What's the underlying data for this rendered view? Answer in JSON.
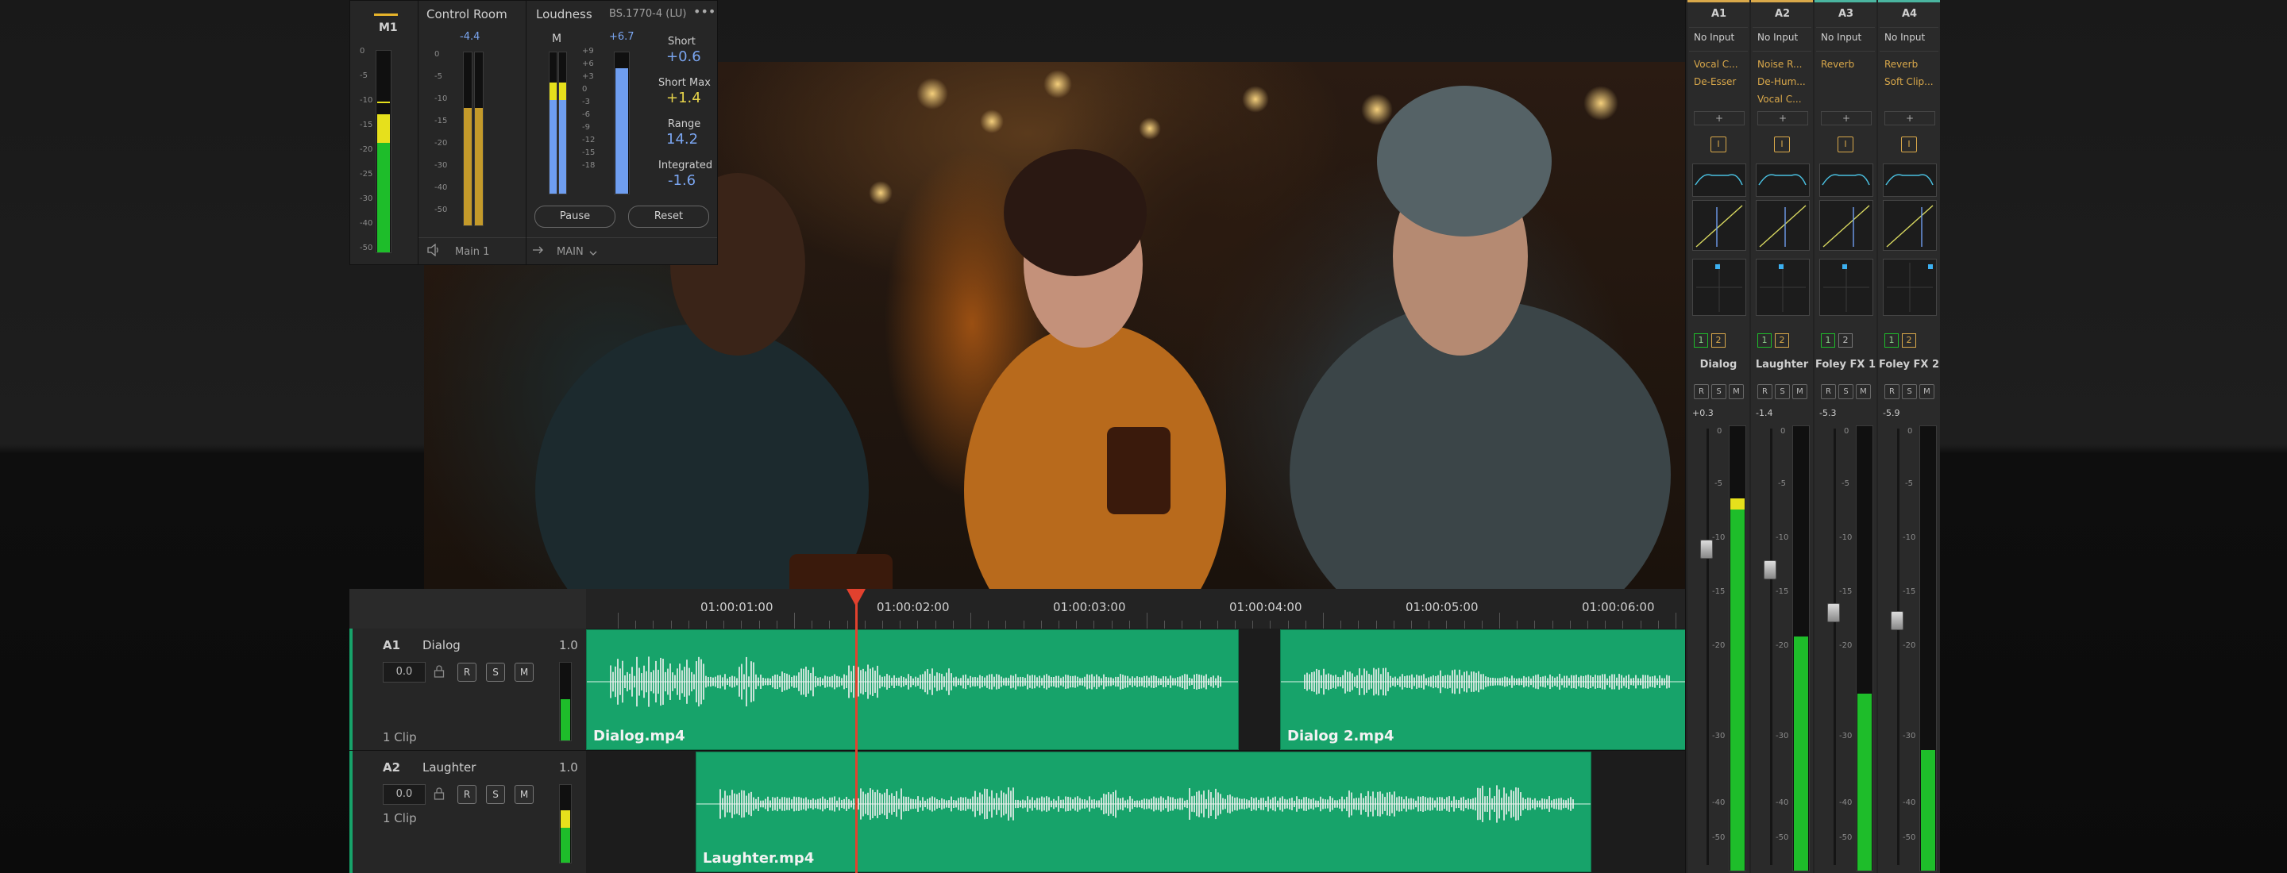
{
  "colors": {
    "accent_green": "#17a36a",
    "playhead": "#e2412e",
    "meter_yellow": "#e6e01c",
    "meter_green": "#1ebd2a",
    "loudness_blue": "#6f9ef0",
    "plugin_orange": "#d9a84a"
  },
  "monitor": {
    "label": "M1",
    "scale": [
      "0",
      "-5",
      "-10",
      "-15",
      "-20",
      "-25",
      "-30",
      "-40",
      "-50"
    ],
    "level": 0.55
  },
  "control_room": {
    "title": "Control Room",
    "peak": "-4.4",
    "scale": [
      "0",
      "-5",
      "-10",
      "-15",
      "-20",
      "-30",
      "-40",
      "-50"
    ],
    "output_label": "Main 1",
    "route_label": "MAIN",
    "speaker_icon": "speaker-icon",
    "arrow_icon": "arrow-icon"
  },
  "loudness": {
    "title": "Loudness",
    "standard": "BS.1770-4 (LU)",
    "menu": "•••",
    "channel": "M",
    "peak": "+6.7",
    "scale": [
      "+9",
      "+6",
      "+3",
      "0",
      "-3",
      "-6",
      "-9",
      "-12",
      "-15",
      "-18"
    ],
    "short_label": "Short",
    "short_value": "+0.6",
    "short_max_label": "Short Max",
    "short_max_value": "+1.4",
    "range_label": "Range",
    "range_value": "14.2",
    "integrated_label": "Integrated",
    "integrated_value": "-1.6",
    "pause_label": "Pause",
    "reset_label": "Reset"
  },
  "timeline": {
    "ruler": [
      "01:00:01:00",
      "01:00:02:00",
      "01:00:03:00",
      "01:00:04:00",
      "01:00:05:00",
      "01:00:06:00"
    ],
    "tracks": [
      {
        "id": "A1",
        "name": "Dialog",
        "volume": "1.0",
        "gain": "0.0",
        "clips_label": "1 Clip",
        "r": "R",
        "s": "S",
        "m": "M"
      },
      {
        "id": "A2",
        "name": "Laughter",
        "volume": "1.0",
        "gain": "0.0",
        "clips_label": "1 Clip",
        "r": "R",
        "s": "S",
        "m": "M"
      }
    ],
    "clips": {
      "dialog1": "Dialog.mp4",
      "dialog2": "Dialog 2.mp4",
      "laughter": "Laughter.mp4"
    }
  },
  "mixer": {
    "strips": [
      {
        "id": "A1",
        "input": "No Input",
        "plugins": [
          "Vocal C...",
          "De-Esser"
        ],
        "name": "Dialog",
        "level": "+0.3",
        "bus1": "1",
        "bus2": "2",
        "r": "R",
        "s": "S",
        "m": "M",
        "fill": 0.57
      },
      {
        "id": "A2",
        "input": "No Input",
        "plugins": [
          "Noise R...",
          "De-Hum...",
          "Vocal C..."
        ],
        "name": "Laughter",
        "level": "-1.4",
        "bus1": "1",
        "bus2": "2",
        "r": "R",
        "s": "S",
        "m": "M",
        "fill": 0.37
      },
      {
        "id": "A3",
        "input": "No Input",
        "plugins": [
          "Reverb"
        ],
        "name": "Foley FX 1",
        "level": "-5.3",
        "bus1": "1",
        "bus2": "2",
        "r": "R",
        "s": "S",
        "m": "M",
        "fill": 0.28
      },
      {
        "id": "A4",
        "input": "No Input",
        "plugins": [
          "Reverb",
          "Soft Clip..."
        ],
        "name": "Foley FX 2",
        "level": "-5.9",
        "bus1": "1",
        "bus2": "2",
        "r": "R",
        "s": "S",
        "m": "M",
        "fill": 0.19
      }
    ],
    "add": "+",
    "insert": "I",
    "scale": [
      "0",
      "-5",
      "-10",
      "-15",
      "-20",
      "-30",
      "-40",
      "-50"
    ]
  }
}
